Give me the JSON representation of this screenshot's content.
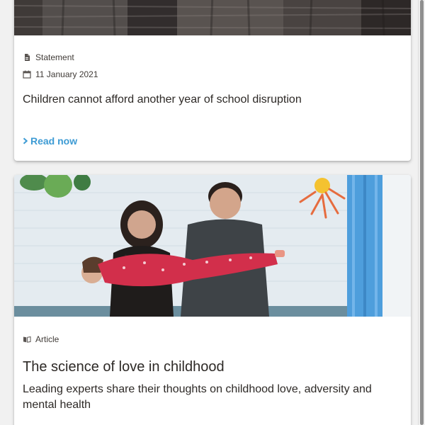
{
  "cards": [
    {
      "type_label": "Statement",
      "type_icon": "document-icon",
      "date": "11 January 2021",
      "date_icon": "calendar-icon",
      "title": "Children cannot afford another year of school disruption",
      "cta_label": "Read now",
      "cta_icon": "chevron-right-icon",
      "image_icon": "photo-image"
    },
    {
      "type_label": "Article",
      "type_icon": "book-icon",
      "title": "The science of love in childhood",
      "description": "Leading experts share their thoughts on childhood love, adversity and mental health",
      "image_icon": "family-photo-image"
    }
  ],
  "colors": {
    "accent": "#3d9bd4",
    "text": "#2d2926",
    "background": "#f1f1f1",
    "card": "#ffffff"
  }
}
